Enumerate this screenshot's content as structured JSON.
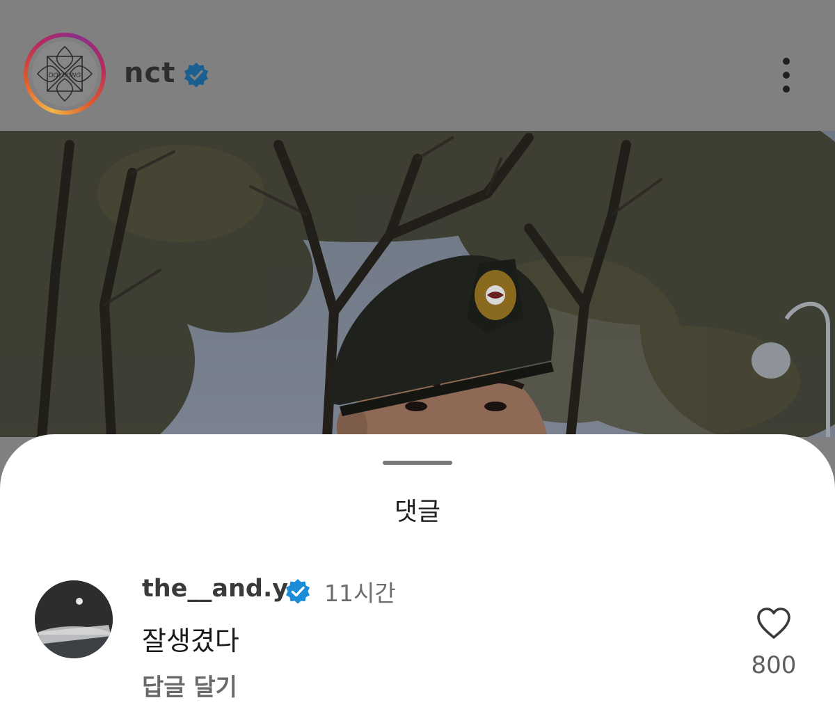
{
  "post": {
    "username": "nct",
    "avatar_icon": "profile-logo-icon",
    "verified_icon": "verified-badge-icon",
    "more_icon": "more-vertical-icon"
  },
  "comments_sheet": {
    "title": "댓글",
    "comments": [
      {
        "username": "the__and.y",
        "verified": true,
        "time": "11시간",
        "text": "잘생겼다",
        "reply_label": "답글 달기",
        "like_icon": "heart-outline-icon",
        "like_count": "800"
      }
    ]
  },
  "colors": {
    "overlay_dim": "#808080",
    "verified_blue": "#1a8cd8",
    "story_ring_start": "#f2b64a",
    "story_ring_end": "#8a2e8a"
  }
}
